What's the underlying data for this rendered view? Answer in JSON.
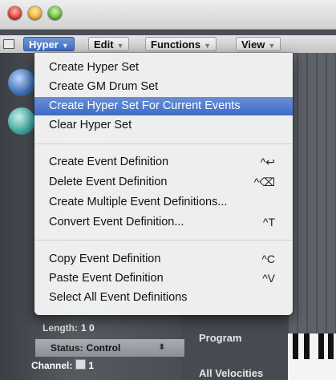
{
  "menubar": {
    "items": [
      {
        "label": "Hyper"
      },
      {
        "label": "Edit"
      },
      {
        "label": "Functions"
      },
      {
        "label": "View"
      }
    ]
  },
  "menu": {
    "groups": [
      [
        {
          "label": "Create Hyper Set",
          "shortcut": ""
        },
        {
          "label": "Create GM Drum Set",
          "shortcut": ""
        },
        {
          "label": "Create Hyper Set For Current Events",
          "shortcut": "",
          "selected": true
        },
        {
          "label": "Clear Hyper Set",
          "shortcut": ""
        }
      ],
      [
        {
          "label": "Create Event Definition",
          "shortcut": "^↩"
        },
        {
          "label": "Delete Event Definition",
          "shortcut": "^⌫"
        },
        {
          "label": "Create Multiple Event Definitions...",
          "shortcut": ""
        },
        {
          "label": "Convert Event Definition...",
          "shortcut": "^T"
        }
      ],
      [
        {
          "label": "Copy Event Definition",
          "shortcut": "^C"
        },
        {
          "label": "Paste Event Definition",
          "shortcut": "^V"
        },
        {
          "label": "Select All Event Definitions",
          "shortcut": ""
        }
      ]
    ]
  },
  "params": {
    "length_label": "Length:",
    "length_value": "1   0",
    "status_label": "Status:",
    "status_value": "Control",
    "channel_label": "Channel:",
    "channel_value": "1"
  },
  "panel": {
    "program": "Program",
    "all_velocities": "All Velocities"
  },
  "colors": {
    "selection": "#3d6cc6",
    "close": "#e0443a",
    "minimize": "#f0b43a",
    "zoom": "#6cc040"
  }
}
